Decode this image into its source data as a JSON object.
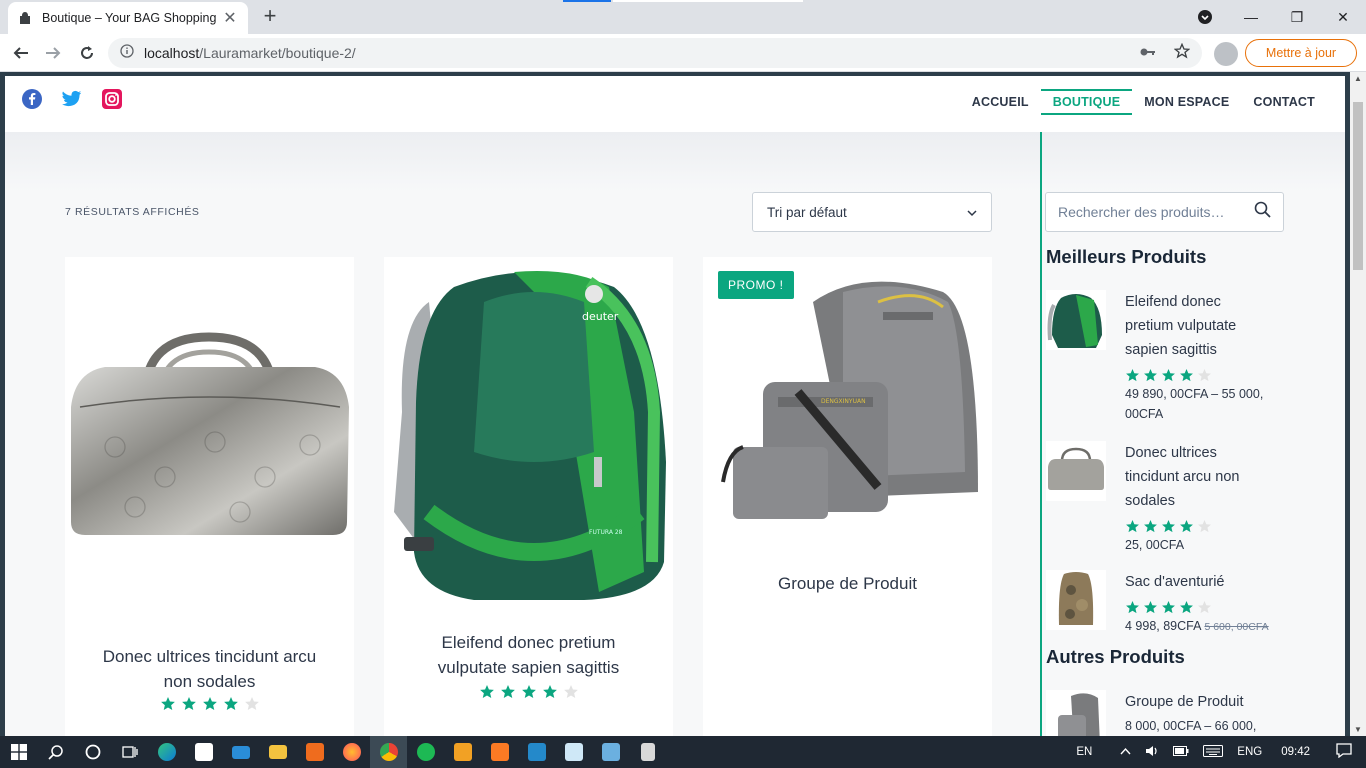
{
  "browser": {
    "tab_title": "Boutique – Your BAG Shopping",
    "url_host": "localhost",
    "url_path": "/Lauramarket/boutique-2/",
    "update_label": "Mettre à jour"
  },
  "header": {
    "nav": [
      "ACCUEIL",
      "BOUTIQUE",
      "MON ESPACE",
      "CONTACT"
    ],
    "active_nav": "BOUTIQUE",
    "social_icons": [
      "facebook-icon",
      "twitter-icon",
      "instagram-icon"
    ]
  },
  "shop": {
    "results_count": "7 RÉSULTATS AFFICHÉS",
    "sort_selected": "Tri par défaut",
    "products": [
      {
        "name_line1": "Donec ultrices tincidunt arcu",
        "name_line2": "non sodales",
        "rating": 4,
        "badge": ""
      },
      {
        "name_line1": "Eleifend donec pretium",
        "name_line2": "vulputate sapien sagittis",
        "rating": 4,
        "badge": ""
      },
      {
        "name_line1": "Groupe de Produit",
        "name_line2": "",
        "rating": 0,
        "badge": "PROMO !"
      }
    ]
  },
  "sidebar": {
    "search_placeholder": "Rechercher des produits…",
    "best_title": "Meilleurs Produits",
    "best": [
      {
        "name_l1": "Eleifend donec",
        "name_l2": "pretium vulputate",
        "name_l3": "sapien sagittis",
        "rating": 4,
        "price_l1": "49 890, 00CFA – 55 000,",
        "price_l2": "00CFA"
      },
      {
        "name_l1": "Donec ultrices",
        "name_l2": "tincidunt arcu non",
        "name_l3": "sodales",
        "rating": 4,
        "price_l1": "25, 00CFA"
      },
      {
        "name_l1": "Sac d'aventurié",
        "rating": 4,
        "price_l1": "4 998, 89CFA",
        "price_old": "5 600, 00CFA"
      }
    ],
    "other_title": "Autres Produits",
    "other": [
      {
        "name_l1": "Groupe de Produit",
        "price_l1": "8 000, 00CFA – 66 000,"
      }
    ]
  },
  "taskbar": {
    "lang_short": "EN",
    "lang": "ENG",
    "time": "09:42"
  },
  "colors": {
    "accent": "#0ba680",
    "star_empty": "#e2e2e2"
  }
}
